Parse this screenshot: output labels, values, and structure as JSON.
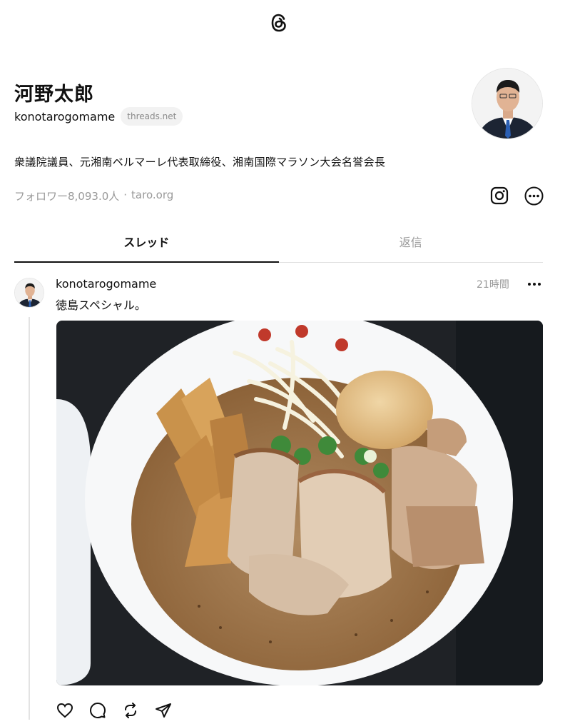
{
  "app": {
    "logo_icon": "threads-logo-icon"
  },
  "profile": {
    "name": "河野太郎",
    "handle": "konotarogomame",
    "domain_chip": "threads.net",
    "bio": "衆議院議員、元湘南ベルマーレ代表取締役、湘南国際マラソン大会名誉会長",
    "followers": "フォロワー8,093.0人",
    "separator": "·",
    "link": "taro.org"
  },
  "tabs": [
    {
      "label": "スレッド",
      "active": true
    },
    {
      "label": "返信",
      "active": false
    }
  ],
  "post": {
    "username": "konotarogomame",
    "time": "21時間",
    "text": "徳島スペシャル。",
    "image_icon": "ramen-bowl-photo"
  },
  "colors": {
    "text": "#101010",
    "muted": "#999999",
    "divider": "#e0e0e0"
  }
}
